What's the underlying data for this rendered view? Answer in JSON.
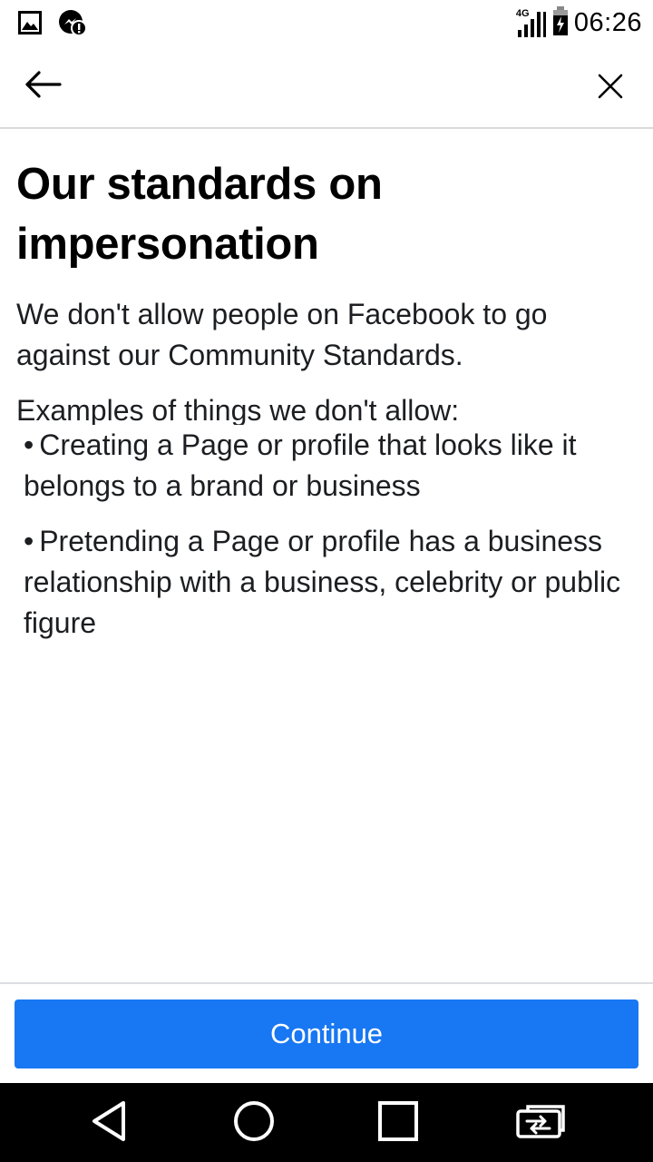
{
  "status_bar": {
    "time": "06:26",
    "network_label": "4G",
    "icons": [
      "image-icon",
      "messenger-notification-icon",
      "signal-icon",
      "battery-charging-icon"
    ]
  },
  "top_nav": {
    "back_icon": "arrow-left-icon",
    "close_icon": "close-icon"
  },
  "content": {
    "title": "Our standards on impersonation",
    "intro": "We don't allow people on Facebook to go against our Community Standards.",
    "examples_heading": "Examples of things we don't allow:",
    "bullets": [
      "Creating a Page or profile that looks like it belongs to a brand or business",
      "Pretending a Page or profile has a business relationship with a business, celebrity or public figure"
    ],
    "bullet_symbol": "•"
  },
  "footer": {
    "continue_label": "Continue",
    "button_color": "#1877f2"
  },
  "system_nav": {
    "icons": [
      "back-triangle-icon",
      "home-circle-icon",
      "recents-square-icon",
      "switch-app-icon"
    ]
  }
}
